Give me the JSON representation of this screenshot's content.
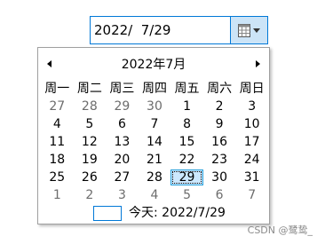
{
  "date_input": {
    "value": "2022/  7/29"
  },
  "calendar": {
    "month_title": "2022年7月",
    "weekdays": [
      "周一",
      "周二",
      "周三",
      "周四",
      "周五",
      "周六",
      "周日"
    ],
    "weeks": [
      [
        "27",
        "28",
        "29",
        "30",
        "1",
        "2",
        "3"
      ],
      [
        "4",
        "5",
        "6",
        "7",
        "8",
        "9",
        "10"
      ],
      [
        "11",
        "12",
        "13",
        "14",
        "15",
        "16",
        "17"
      ],
      [
        "18",
        "19",
        "20",
        "21",
        "22",
        "23",
        "24"
      ],
      [
        "25",
        "26",
        "27",
        "28",
        "29",
        "30",
        "31"
      ],
      [
        "1",
        "2",
        "3",
        "4",
        "5",
        "6",
        "7"
      ]
    ],
    "today_label": "今天: 2022/7/29"
  },
  "watermark": "CSDN @鹭鸷_"
}
